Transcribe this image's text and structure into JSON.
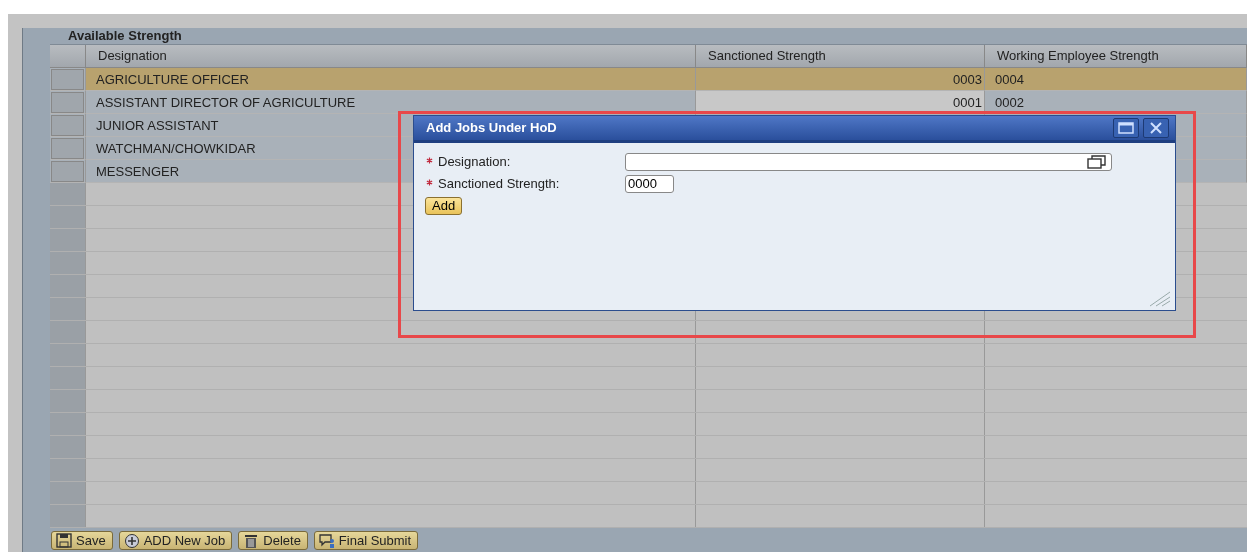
{
  "table": {
    "title": "Available Strength",
    "columns": [
      "Designation",
      "Sanctioned Strength",
      "Working Employee Strength"
    ],
    "rows": [
      {
        "designation": "AGRICULTURE OFFICER",
        "sanctioned": "0003",
        "working": "0004",
        "selected": true
      },
      {
        "designation": "ASSISTANT DIRECTOR OF AGRICULTURE",
        "sanctioned": "0001",
        "working": "0002",
        "selected": false
      },
      {
        "designation": "JUNIOR ASSISTANT",
        "selected": false
      },
      {
        "designation": "WATCHMAN/CHOWKIDAR",
        "selected": false
      },
      {
        "designation": "MESSENGER",
        "selected": false
      }
    ]
  },
  "toolbar": [
    {
      "label": "Save"
    },
    {
      "label": "ADD New Job"
    },
    {
      "label": "Delete"
    },
    {
      "label": "Final Submit"
    }
  ],
  "dialog": {
    "title": "Add Jobs Under HoD",
    "fields": [
      {
        "label": "Designation:",
        "required": true,
        "kind": "lookup"
      },
      {
        "label": "Sanctioned Strength:",
        "required": true,
        "kind": "text",
        "value": "0000"
      }
    ],
    "button": "Add"
  }
}
